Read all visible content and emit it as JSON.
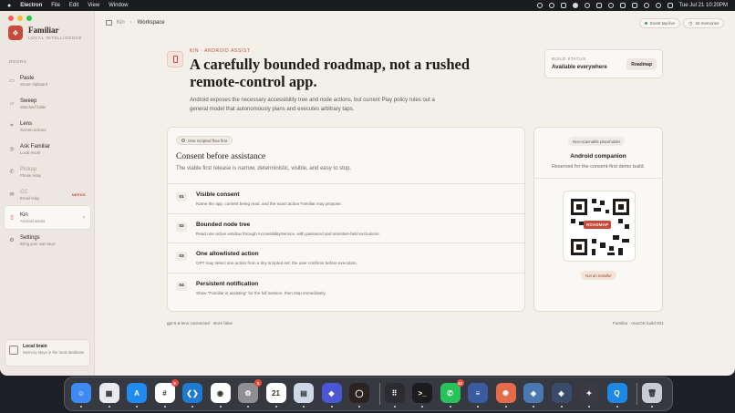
{
  "menubar": {
    "app_name": "Electron",
    "menus": [
      "File",
      "Edit",
      "View",
      "Window"
    ],
    "clock": "Tue Jul 21  10:20PM"
  },
  "sidebar": {
    "brand_name": "Familiar",
    "brand_sub": "LOCAL INTELLIGENCE",
    "section_label": "DOORS",
    "items": [
      {
        "label": "Paste",
        "sub": "Smart clipboard",
        "icon": "paste-icon"
      },
      {
        "label": "Sweep",
        "sub": "Watched folder",
        "icon": "sweep-icon"
      },
      {
        "label": "Lens",
        "sub": "Screen actions",
        "icon": "lens-icon"
      },
      {
        "label": "Ask Familiar",
        "sub": "Local recall",
        "icon": "ask-icon"
      },
      {
        "label": "Pickup",
        "sub": "Phone relay",
        "icon": "phone-icon"
      },
      {
        "label": "CC",
        "sub": "Email relay",
        "icon": "mail-icon",
        "badge": "NEEDS"
      },
      {
        "label": "Kin",
        "sub": "Android assist",
        "icon": "android-icon"
      },
      {
        "label": "Settings",
        "sub": "Bring your own keys",
        "icon": "gear-icon"
      }
    ],
    "local_brain": {
      "title": "Local brain",
      "sub": "Memory stays in the local database"
    }
  },
  "toolbar": {
    "crumb_root": "Kin",
    "crumb_current": "Workspace",
    "event_pill": "Event tap live",
    "memories_pill": "32 memories"
  },
  "hero": {
    "eyebrow": "KIN · ANDROID ASSIST",
    "title": "A carefully bounded roadmap, not a rushed remote-control app.",
    "description": "Android exposes the necessary accessibility tree and node actions, but current Play policy rules out a general model that autonomously plans and executes arbitrary taps."
  },
  "build_status": {
    "label": "BUILD STATUS",
    "value": "Available everywhere",
    "button": "Roadmap"
  },
  "consent": {
    "tag": "One scripted flow first",
    "title": "Consent before assistance",
    "subtitle": "The viable first release is narrow, deterministic, visible, and easy to stop.",
    "steps": [
      {
        "num": "01",
        "title": "Visible consent",
        "desc": "Name the app, content being read, and the exact action Familiar may propose."
      },
      {
        "num": "02",
        "title": "Bounded node tree",
        "desc": "Read one active window through AccessibilityService, with password and sensitive-field exclusions."
      },
      {
        "num": "03",
        "title": "One allowlisted action",
        "desc": "GPT may select one action from a tiny scripted set; the user confirms before execution."
      },
      {
        "num": "04",
        "title": "Persistent notification",
        "desc": "Show \"Familiar is assisting\" for the full session, then stop immediately."
      }
    ]
  },
  "companion": {
    "tag": "Non-scannable placeholder",
    "title": "Android companion",
    "subtitle": "Reserved for the consent-first demo build.",
    "qr_badge": "ROADMAP",
    "status_badge": "Not an installer"
  },
  "footer": {
    "left": "gpt-5.6-lens connected · store false",
    "right": "Familiar · macOS build 001"
  },
  "dock": {
    "items": [
      {
        "name": "finder",
        "color": "#3d8bf0",
        "glyph": "☺"
      },
      {
        "name": "launchpad",
        "color": "#e9e9ee",
        "glyph": "▦"
      },
      {
        "name": "app-store",
        "color": "#1f8af0",
        "glyph": "A"
      },
      {
        "name": "slack",
        "color": "#ffffff",
        "glyph": "#",
        "badge": "9"
      },
      {
        "name": "vscode",
        "color": "#1f7ad1",
        "glyph": "❮❯"
      },
      {
        "name": "chrome",
        "color": "#ffffff",
        "glyph": "◉"
      },
      {
        "name": "system-settings",
        "color": "#8e8e93",
        "glyph": "⚙",
        "badge": "1"
      },
      {
        "name": "calendar",
        "color": "#ffffff",
        "glyph": "21"
      },
      {
        "name": "preview",
        "color": "#cfd8e6",
        "glyph": "▤"
      },
      {
        "name": "proton",
        "color": "#4a58d6",
        "glyph": "◆"
      },
      {
        "name": "ring-app",
        "color": "#2a2420",
        "glyph": "◯"
      },
      {
        "name": "app-grid",
        "color": "#2b2b30",
        "glyph": "⠿"
      },
      {
        "name": "terminal",
        "color": "#1c1c1e",
        "glyph": ">_"
      },
      {
        "name": "whatsapp",
        "color": "#27c35a",
        "glyph": "✆",
        "badge": "42"
      },
      {
        "name": "database",
        "color": "#3b5ba0",
        "glyph": "≡"
      },
      {
        "name": "claude",
        "color": "#e56a4a",
        "glyph": "✺"
      },
      {
        "name": "cube-app",
        "color": "#4a78b0",
        "glyph": "◈"
      },
      {
        "name": "cube-app-2",
        "color": "#3a4a6a",
        "glyph": "◈"
      },
      {
        "name": "gpt-app",
        "color": "#3a3a40",
        "glyph": "✦"
      },
      {
        "name": "q-app",
        "color": "#1e88e5",
        "glyph": "Q"
      },
      {
        "name": "trash",
        "color": "#c9ccd2",
        "glyph": "🗑"
      }
    ]
  }
}
